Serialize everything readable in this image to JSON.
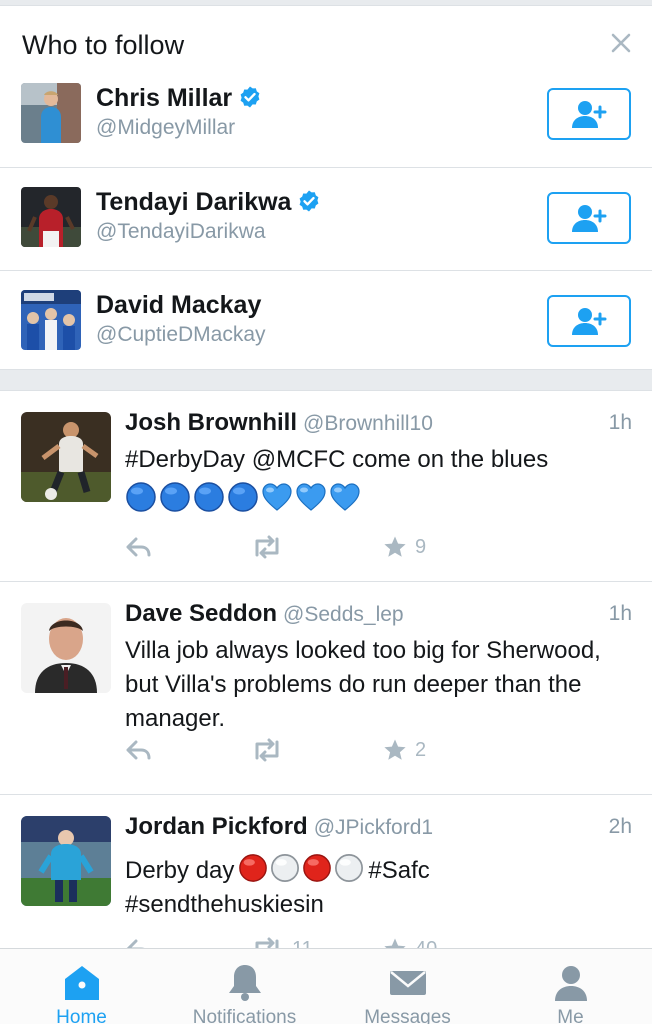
{
  "who_to_follow": {
    "title": "Who to follow",
    "close_icon": "close-icon",
    "suggestions": [
      {
        "name": "Chris Millar",
        "handle": "@MidgeyMillar",
        "verified": true
      },
      {
        "name": "Tendayi Darikwa",
        "handle": "@TendayiDarikwa",
        "verified": true
      },
      {
        "name": "David Mackay",
        "handle": "@CuptieDMackay",
        "verified": false
      }
    ],
    "follow_icon": "add-user-icon"
  },
  "timeline": {
    "tweets": [
      {
        "name": "Josh Brownhill",
        "handle": "@Brownhill10",
        "time": "1h",
        "text": "#DerbyDay @MCFC come on the blues",
        "emoji": [
          "blue-circle",
          "blue-circle",
          "blue-circle",
          "blue-circle",
          "blue-heart",
          "blue-heart",
          "blue-heart"
        ],
        "retweets": "",
        "favorites": "9"
      },
      {
        "name": "Dave Seddon",
        "handle": "@Sedds_lep",
        "time": "1h",
        "text": "Villa job always looked too big for Sherwood, but Villa's problems do run deeper than the manager.",
        "retweets": "",
        "favorites": "2"
      },
      {
        "name": "Jordan Pickford",
        "handle": "@JPickford1",
        "time": "2h",
        "text_before": "Derby day",
        "emoji": [
          "red-circle",
          "white-circle",
          "red-circle",
          "white-circle"
        ],
        "text_after": "#Safc",
        "text_line2": "#sendthehuskiesin",
        "retweets": "11",
        "favorites": "40"
      }
    ]
  },
  "tabbar": {
    "tabs": [
      {
        "label": "Home",
        "icon": "home-icon",
        "active": true
      },
      {
        "label": "Notifications",
        "icon": "bell-icon",
        "active": false
      },
      {
        "label": "Messages",
        "icon": "envelope-icon",
        "active": false
      },
      {
        "label": "Me",
        "icon": "person-icon",
        "active": false
      }
    ]
  },
  "colors": {
    "accent": "#1da1f2",
    "muted": "#8899a6",
    "icon_muted": "#aab8c2"
  }
}
